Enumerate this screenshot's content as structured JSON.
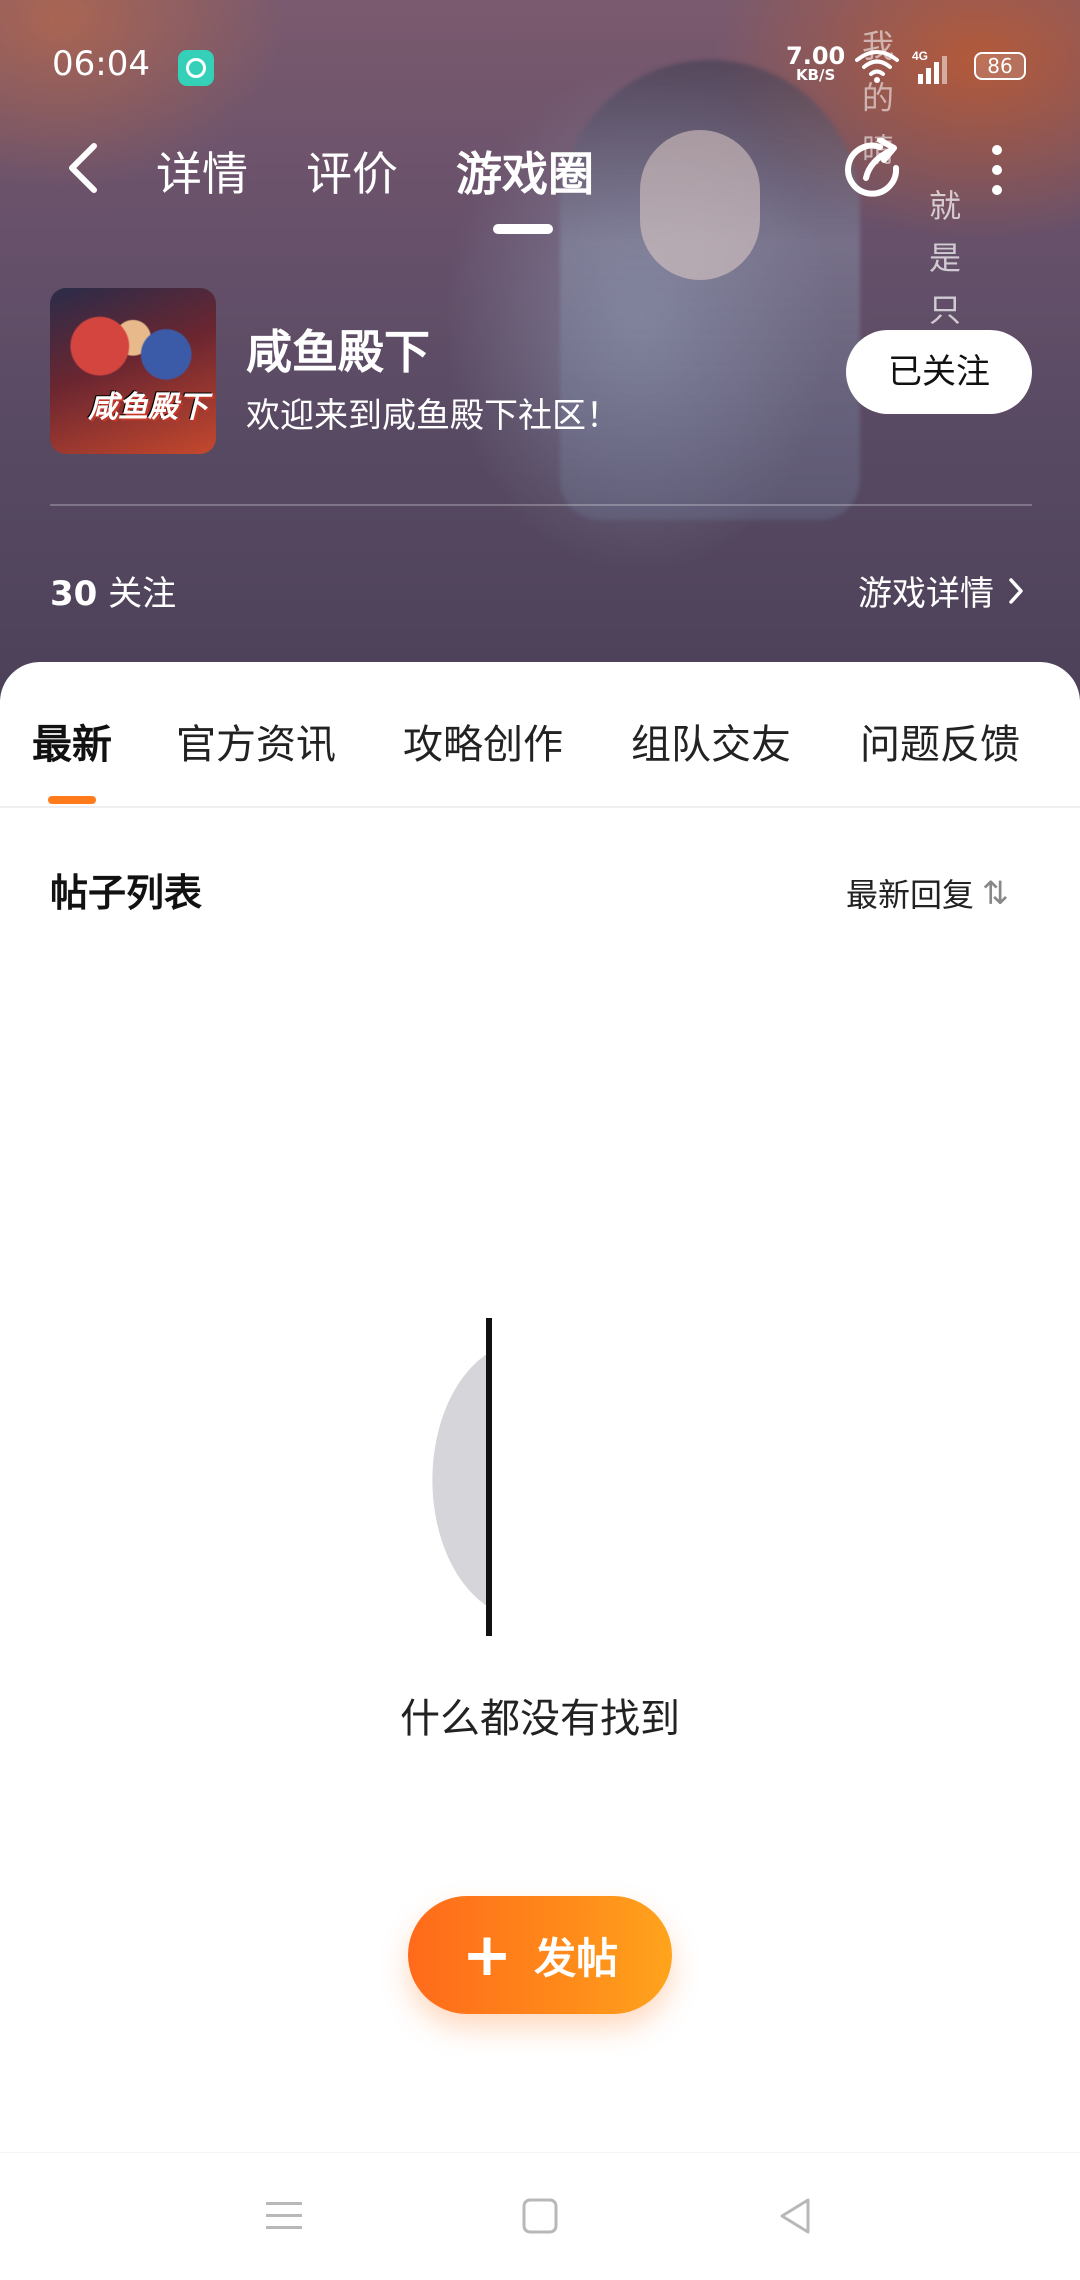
{
  "status_bar": {
    "time": "06:04",
    "net_speed_value": "7.00",
    "net_speed_unit": "KB/S",
    "network_type": "4G",
    "battery": "86"
  },
  "nav": {
    "tabs": [
      {
        "label": "详情",
        "active": false
      },
      {
        "label": "评价",
        "active": false
      },
      {
        "label": "游戏圈",
        "active": true
      }
    ]
  },
  "hero": {
    "vertical_text_1": "我的晴",
    "vertical_text_2": "就是只"
  },
  "game": {
    "title": "咸鱼殿下",
    "subtitle": "欢迎来到咸鱼殿下社区！",
    "cover_logo": "咸鱼殿下",
    "follow_button": "已关注",
    "follow_count": "30",
    "follow_label": "关注",
    "details_link": "游戏详情"
  },
  "categories": [
    {
      "label": "最新",
      "active": true
    },
    {
      "label": "官方资讯",
      "active": false
    },
    {
      "label": "攻略创作",
      "active": false
    },
    {
      "label": "组队交友",
      "active": false
    },
    {
      "label": "问题反馈",
      "active": false
    }
  ],
  "list": {
    "title": "帖子列表",
    "sort_label": "最新回复",
    "sort_icon": "⇅"
  },
  "empty": {
    "message": "什么都没有找到"
  },
  "post_button": {
    "label": "发帖",
    "icon": "+"
  },
  "colors": {
    "accent": "#ff7a1a",
    "hero_bg": "#5e4b66"
  }
}
